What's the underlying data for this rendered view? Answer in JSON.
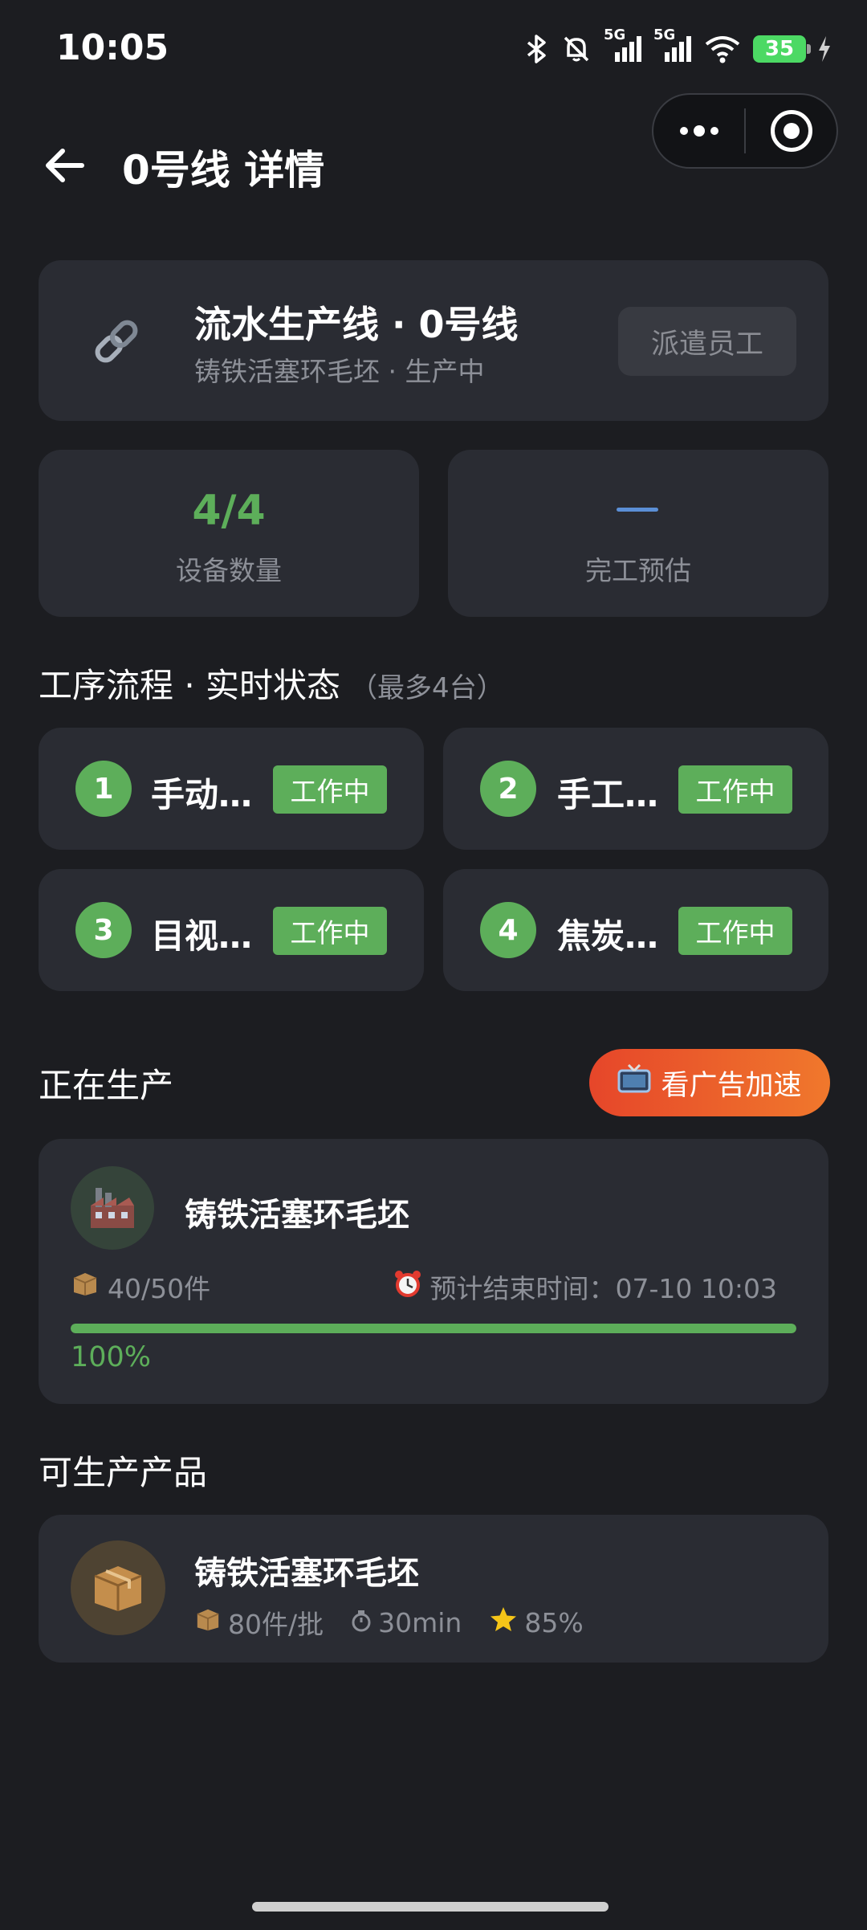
{
  "status_bar": {
    "time": "10:05",
    "battery": "35",
    "net1": "5G",
    "net2": "5G"
  },
  "header": {
    "title": "0号线 详情"
  },
  "line_info": {
    "name": "流水生产线 · 0号线",
    "subtitle": "铸铁活塞环毛坯 · 生产中",
    "dispatch_label": "派遣员工",
    "icon": "link-icon"
  },
  "stats": {
    "devices_value": "4/4",
    "devices_label": "设备数量",
    "eta_value": "—",
    "eta_label": "完工预估"
  },
  "process": {
    "title": "工序流程 · 实时状态",
    "note": "（最多4台）",
    "steps": [
      {
        "num": "1",
        "name": "手动…",
        "status": "工作中"
      },
      {
        "num": "2",
        "name": "手工…",
        "status": "工作中"
      },
      {
        "num": "3",
        "name": "目视…",
        "status": "工作中"
      },
      {
        "num": "4",
        "name": "焦炭…",
        "status": "工作中"
      }
    ]
  },
  "producing": {
    "title": "正在生产",
    "ad_label": "看广告加速",
    "ad_icon": "tv-icon",
    "product_name": "铸铁活塞环毛坯",
    "product_icon": "factory-icon",
    "quantity": "40/50件",
    "eta": "预计结束时间：07-10 10:03",
    "progress": 1.0,
    "progress_label": "100%"
  },
  "available": {
    "title": "可生产产品",
    "items": [
      {
        "name": "铸铁活塞环毛坯",
        "batch": "80件/批",
        "time": "30min",
        "rate": "85%",
        "icon": "box-icon"
      }
    ]
  },
  "colors": {
    "background": "#1c1d21",
    "card": "#2a2c33",
    "accent_green": "#5dae5a",
    "ad_orange": "#ee5a2a"
  }
}
